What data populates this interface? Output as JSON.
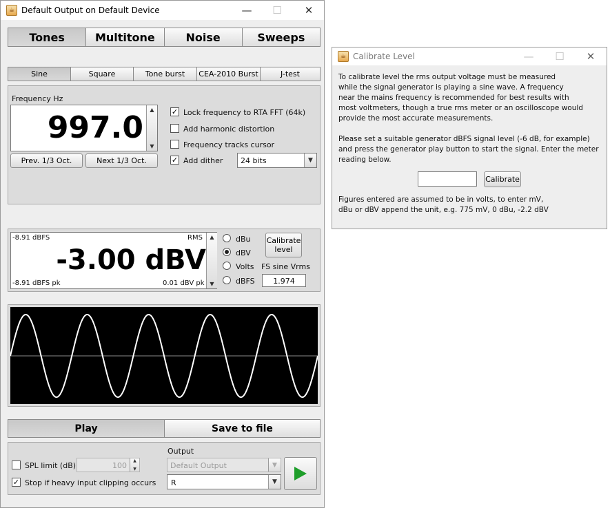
{
  "main_window": {
    "title": "Default Output on Default Device",
    "controls": {
      "minimize": "—",
      "maximize": "☐",
      "close": "✕"
    }
  },
  "top_tabs": [
    {
      "label": "Tones",
      "selected": true
    },
    {
      "label": "Multitone",
      "selected": false
    },
    {
      "label": "Noise",
      "selected": false
    },
    {
      "label": "Sweeps",
      "selected": false
    }
  ],
  "sub_tabs": [
    {
      "label": "Sine",
      "selected": true
    },
    {
      "label": "Square",
      "selected": false
    },
    {
      "label": "Tone burst",
      "selected": false
    },
    {
      "label": "CEA-2010 Burst",
      "selected": false
    },
    {
      "label": "J-test",
      "selected": false
    }
  ],
  "frequency": {
    "label": "Frequency Hz",
    "value": "997.0",
    "prev_button": "Prev. 1/3 Oct.",
    "next_button": "Next 1/3 Oct."
  },
  "options": {
    "lock_frequency": {
      "label": "Lock frequency to RTA FFT (64k)",
      "checked": true
    },
    "harmonic_distortion": {
      "label": "Add harmonic distortion",
      "checked": false
    },
    "tracks_cursor": {
      "label": "Frequency tracks cursor",
      "checked": false
    },
    "add_dither": {
      "label": "Add dither",
      "checked": true
    },
    "dither_bits": "24 bits"
  },
  "level": {
    "top_left": "-8.91 dBFS",
    "top_right": "RMS",
    "value": "-3.00 dBV",
    "bottom_left": "-8.91 dBFS pk",
    "bottom_right": "0.01 dBV pk",
    "units": [
      {
        "label": "dBu",
        "selected": false
      },
      {
        "label": "dBV",
        "selected": true
      },
      {
        "label": "Volts",
        "selected": false
      },
      {
        "label": "dBFS",
        "selected": false
      }
    ],
    "calibrate_line1": "Calibrate",
    "calibrate_line2": "level",
    "fs_label": "FS sine Vrms",
    "fs_value": "1.974"
  },
  "waveform": {
    "cycles": 5,
    "line_color": "#ffffff",
    "background": "#000000",
    "axis_color": "#8c8c8c"
  },
  "actions": {
    "play": "Play",
    "save": "Save to file"
  },
  "bottom": {
    "spl_limit": {
      "label": "SPL limit (dB):",
      "checked": false,
      "value": "100"
    },
    "stop_clipping": {
      "label": "Stop if heavy input clipping occurs",
      "checked": true
    },
    "output_label": "Output",
    "output_device": "Default Output",
    "output_channel": "R",
    "play_icon": "play-triangle-icon",
    "play_color": "#1e9e2a"
  },
  "calibrate_dialog": {
    "title": "Calibrate Level",
    "controls": {
      "minimize": "—",
      "maximize": "☐",
      "close": "✕"
    },
    "para1": [
      "To calibrate level the rms output voltage must be measured",
      "while the signal generator is playing a sine wave. A frequency",
      "near the mains frequency is recommended for best results with",
      "most voltmeters, though a true rms meter or an oscilloscope would",
      "provide the most accurate measurements."
    ],
    "para2": [
      "Please set a suitable generator dBFS signal level (-6 dB, for example)",
      "and press the generator play button to start the signal. Enter the meter",
      "reading below."
    ],
    "input_value": "",
    "calibrate_button": "Calibrate",
    "para3": [
      "Figures entered are assumed to be in volts, to enter mV,",
      "dBu or dBV append the unit, e.g. 775 mV, 0 dBu, -2.2 dBV"
    ]
  }
}
